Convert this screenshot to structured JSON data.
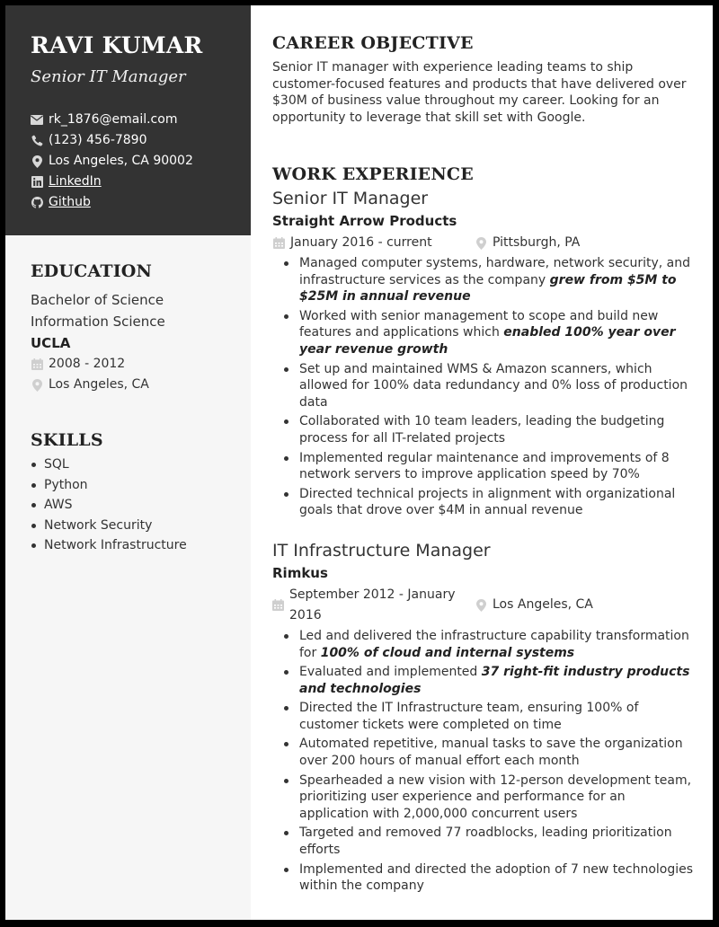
{
  "header": {
    "name": "RAVI KUMAR",
    "title": "Senior IT Manager",
    "contacts": {
      "email": "rk_1876@email.com",
      "phone": "(123) 456-7890",
      "location": "Los Angeles, CA 90002",
      "linkedin": "LinkedIn",
      "github": "Github"
    }
  },
  "education": {
    "heading": "EDUCATION",
    "degree": "Bachelor of Science",
    "field": "Information Science",
    "school": "UCLA",
    "dates": "2008 - 2012",
    "location": "Los Angeles, CA"
  },
  "skills": {
    "heading": "SKILLS",
    "items": [
      "SQL",
      "Python",
      "AWS",
      "Network Security",
      "Network Infrastructure"
    ]
  },
  "objective": {
    "heading": "CAREER OBJECTIVE",
    "text": "Senior IT manager with experience leading teams to ship customer-focused features and products that have delivered over $30M of business value throughout my career. Looking for an opportunity to leverage that skill set with Google."
  },
  "work": {
    "heading": "WORK EXPERIENCE",
    "jobs": [
      {
        "title": "Senior IT Manager",
        "company": "Straight Arrow Products",
        "dates": "January 2016 - current",
        "location": "Pittsburgh, PA",
        "bullets": [
          {
            "text": "Managed computer systems, hardware, network security, and infrastructure services as the company ",
            "bold": "grew from $5M to $25M in annual revenue",
            "after": ""
          },
          {
            "text": "Worked with senior management to scope and build new features and applications which ",
            "bold": "enabled 100% year over year revenue growth",
            "after": ""
          },
          {
            "text": "Set up and maintained WMS & Amazon scanners, which allowed for 100% data redundancy and 0% loss of production data",
            "bold": "",
            "after": ""
          },
          {
            "text": "Collaborated with 10 team leaders, leading the budgeting process for all IT-related projects",
            "bold": "",
            "after": ""
          },
          {
            "text": "Implemented regular maintenance and improvements of 8 network servers to improve application speed by 70%",
            "bold": "",
            "after": ""
          },
          {
            "text": "Directed technical projects in alignment with organizational goals that drove over $4M in annual revenue",
            "bold": "",
            "after": ""
          }
        ]
      },
      {
        "title": "IT Infrastructure Manager",
        "company": "Rimkus",
        "dates": "September 2012 - January 2016",
        "location": "Los Angeles, CA",
        "bullets": [
          {
            "text": "Led and delivered the infrastructure capability transformation for ",
            "bold": "100% of cloud and internal systems",
            "after": ""
          },
          {
            "text": "Evaluated and implemented ",
            "bold": "37 right-fit industry products and technologies",
            "after": ""
          },
          {
            "text": "Directed the IT Infrastructure team, ensuring 100% of customer tickets were completed on time",
            "bold": "",
            "after": ""
          },
          {
            "text": "Automated repetitive, manual tasks to save the organization over 200 hours of manual effort each month",
            "bold": "",
            "after": ""
          },
          {
            "text": "Spearheaded a new vision with 12-person development team, prioritizing user experience and performance for an application with 2,000,000 concurrent users",
            "bold": "",
            "after": ""
          },
          {
            "text": "Targeted and removed 77 roadblocks, leading prioritization efforts",
            "bold": "",
            "after": ""
          },
          {
            "text": "Implemented and directed the adoption of 7 new technologies within the company",
            "bold": "",
            "after": ""
          }
        ]
      }
    ]
  }
}
